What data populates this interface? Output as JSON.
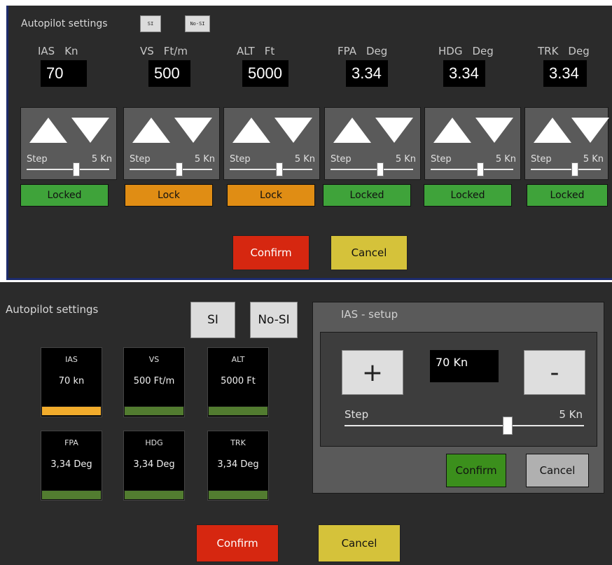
{
  "top": {
    "title": "Autopilot settings",
    "si_label": "SI",
    "nosi_label": "No-SI",
    "params": [
      {
        "name": "IAS",
        "unit": "Kn",
        "value": "70",
        "step_label": "Step",
        "step_value": "5 Kn",
        "status": "Locked",
        "slider_level": 0.6
      },
      {
        "name": "VS",
        "unit": "Ft/m",
        "value": "500",
        "step_label": "Step",
        "step_value": "5 Kn",
        "status": "Lock",
        "slider_level": 0.6
      },
      {
        "name": "ALT",
        "unit": "Ft",
        "value": "5000",
        "step_label": "Step",
        "step_value": "5 Kn",
        "status": "Lock",
        "slider_level": 0.6
      },
      {
        "name": "FPA",
        "unit": "Deg",
        "value": "3.34",
        "step_label": "Step",
        "step_value": "5 Kn",
        "status": "Locked",
        "slider_level": 0.6
      },
      {
        "name": "HDG",
        "unit": "Deg",
        "value": "3.34",
        "step_label": "Step",
        "step_value": "5 Kn",
        "status": "Locked",
        "slider_level": 0.6
      },
      {
        "name": "TRK",
        "unit": "Deg",
        "value": "3.34",
        "step_label": "Step",
        "step_value": "5 Kn",
        "status": "Locked",
        "slider_level": 0.6
      }
    ],
    "confirm_label": "Confirm",
    "cancel_label": "Cancel"
  },
  "bottom": {
    "title": "Autopilot settings",
    "si_label": "SI",
    "nosi_label": "No-SI",
    "tiles": [
      {
        "name": "IAS",
        "value": "70 kn",
        "bar": "orange"
      },
      {
        "name": "VS",
        "value": "500 Ft/m",
        "bar": "green"
      },
      {
        "name": "ALT",
        "value": "5000 Ft",
        "bar": "green"
      },
      {
        "name": "FPA",
        "value": "3,34 Deg",
        "bar": "green"
      },
      {
        "name": "HDG",
        "value": "3,34 Deg",
        "bar": "green"
      },
      {
        "name": "TRK",
        "value": "3,34 Deg",
        "bar": "green"
      }
    ],
    "setup": {
      "title": "IAS - setup",
      "plus": "+",
      "minus": "-",
      "value": "70 Kn",
      "step_label": "Step",
      "step_value": "5 Kn",
      "slider_level": 0.7,
      "confirm_label": "Confirm",
      "cancel_label": "Cancel"
    },
    "confirm_label": "Confirm",
    "cancel_label": "Cancel"
  },
  "colors": {
    "background": "#2b2b2b",
    "locked": "#3fa33a",
    "lock": "#e08d14",
    "confirm": "#d62710",
    "cancel": "#d5c23a",
    "bar_orange": "#f2ac2c",
    "bar_green": "#527c30"
  }
}
